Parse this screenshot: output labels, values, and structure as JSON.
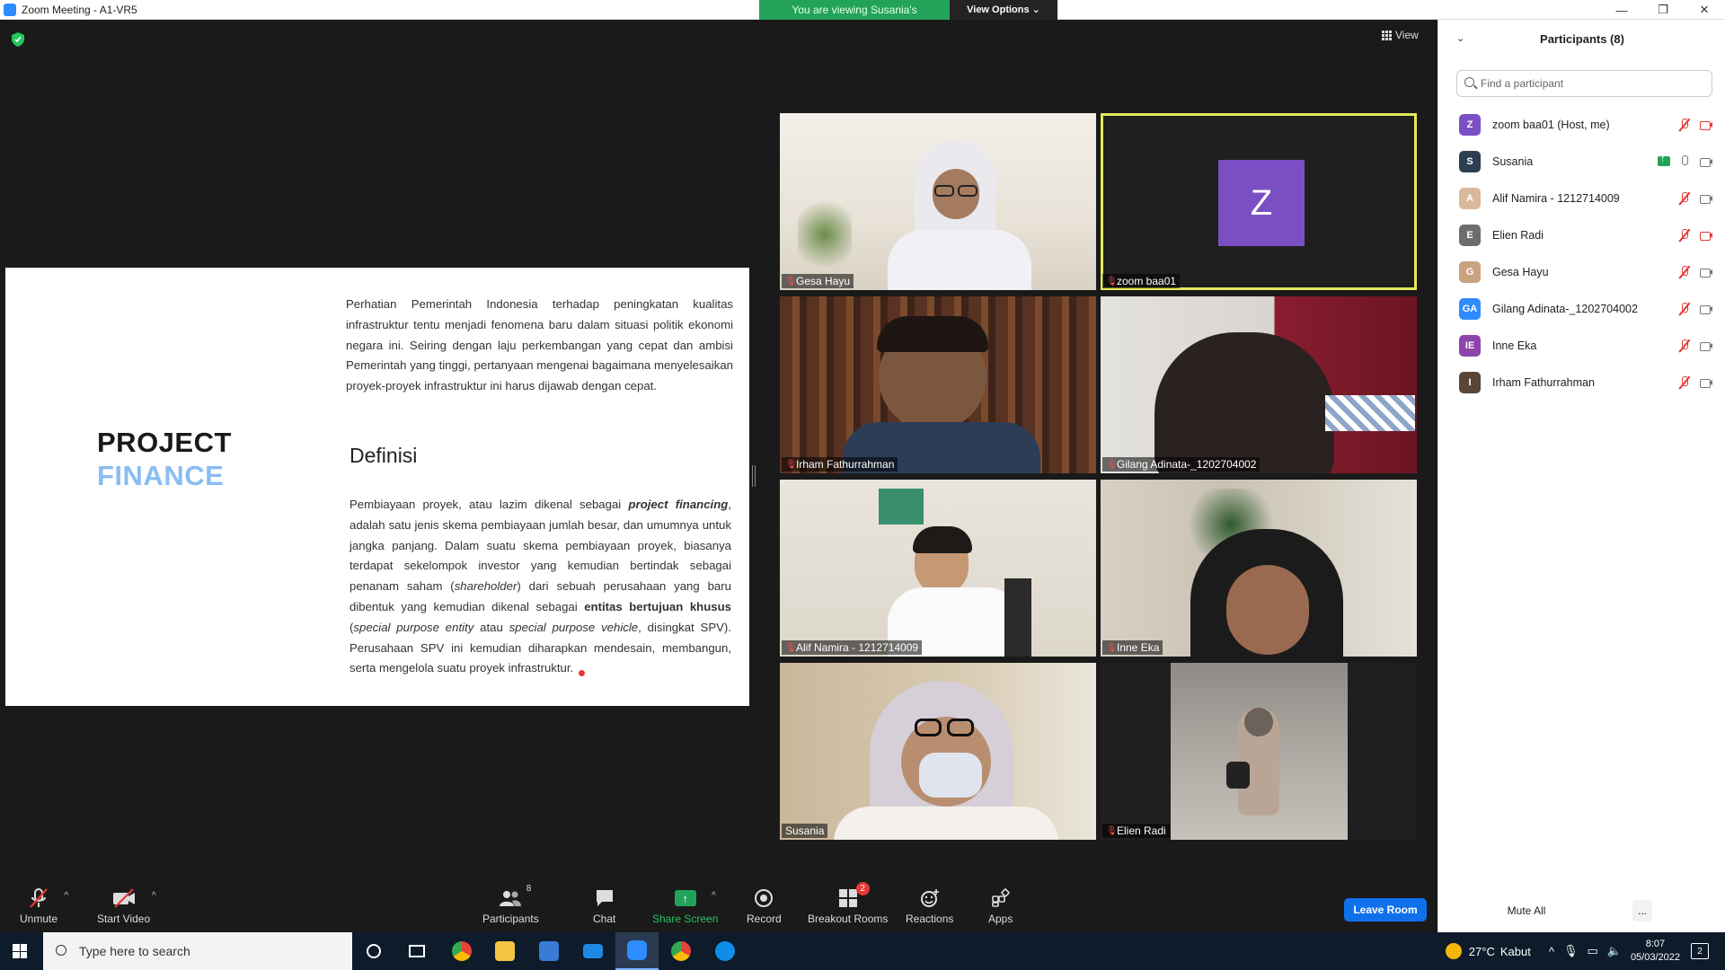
{
  "window": {
    "title": "Zoom Meeting - A1-VR5",
    "controls": [
      "—",
      "❐",
      "✕"
    ]
  },
  "share_banner": {
    "viewing_text": "You are viewing Susania's screen",
    "view_options_label": "View Options ⌄"
  },
  "meeting": {
    "view_label": "View"
  },
  "slide": {
    "heading_line1": "PROJECT",
    "heading_line2": "FINANCE",
    "paragraph1": "Perhatian Pemerintah Indonesia terhadap peningkatan kualitas infrastruktur tentu menjadi fenomena baru dalam situasi politik ekonomi negara ini. Seiring dengan laju perkembangan yang cepat dan ambisi Pemerintah yang tinggi, pertanyaan mengenai bagaimana menyelesaikan proyek-proyek infrastruktur ini harus dijawab dengan cepat.",
    "definition_title": "Definisi",
    "paragraph2_a": "Pembiayaan proyek, atau lazim dikenal sebagai ",
    "paragraph2_b": "project financing",
    "paragraph2_c": ", adalah satu jenis skema pembiayaan jumlah besar, dan umumnya untuk jangka panjang. Dalam suatu skema pembiayaan proyek, biasanya terdapat sekelompok investor yang kemudian bertindak sebagai penanam saham (",
    "paragraph2_d": "shareholder",
    "paragraph2_e": ") dari sebuah perusahaan yang baru dibentuk yang kemudian dikenal sebagai ",
    "paragraph2_f": "entitas bertujuan khusus",
    "paragraph2_g": " (",
    "paragraph2_h": "special purpose entity",
    "paragraph2_i": " atau ",
    "paragraph2_j": "special purpose vehicle",
    "paragraph2_k": ", disingkat SPV). Perusahaan SPV ini kemudian diharapkan mendesain, membangun, serta mengelola suatu proyek infrastruktur."
  },
  "gallery": [
    {
      "name": "Gesa Hayu",
      "muted": true
    },
    {
      "name": "zoom baa01",
      "muted": true,
      "avatar_letter": "Z",
      "active": true
    },
    {
      "name": "Irham Fathurrahman",
      "muted": true
    },
    {
      "name": "Gilang Adinata-_1202704002",
      "muted": true
    },
    {
      "name": "Alif Namira - 1212714009",
      "muted": true
    },
    {
      "name": "Inne Eka",
      "muted": true
    },
    {
      "name": "Susania",
      "muted": false
    },
    {
      "name": "Elien Radi",
      "muted": true
    }
  ],
  "participants": {
    "header": "Participants (8)",
    "collapse_icon": "⌄",
    "search_placeholder": "Find a participant",
    "list": [
      {
        "initials": "Z",
        "name": "zoom baa01 (Host, me)",
        "color": "#7b4fc4",
        "mic": "off",
        "cam": "off"
      },
      {
        "initials": "S",
        "name": "Susania",
        "color": "#2c3e50",
        "mic": "on",
        "cam": "on",
        "sharing": true
      },
      {
        "initials": "A",
        "name": "Alif Namira - 1212714009",
        "color": "#d9b99b",
        "mic": "off",
        "cam": "on"
      },
      {
        "initials": "E",
        "name": "Elien Radi",
        "color": "#6d6d6d",
        "mic": "off",
        "cam": "off"
      },
      {
        "initials": "G",
        "name": "Gesa Hayu",
        "color": "#c9a27e",
        "mic": "off",
        "cam": "on"
      },
      {
        "initials": "GA",
        "name": "Gilang Adinata-_1202704002",
        "color": "#2d8cff",
        "mic": "off",
        "cam": "on"
      },
      {
        "initials": "IE",
        "name": "Inne Eka",
        "color": "#8e44ad",
        "mic": "off",
        "cam": "on"
      },
      {
        "initials": "I",
        "name": "Irham Fathurrahman",
        "color": "#5a4636",
        "mic": "off",
        "cam": "on"
      }
    ],
    "mute_all_label": "Mute All",
    "more_label": "..."
  },
  "toolbar": {
    "unmute": "Unmute",
    "start_video": "Start Video",
    "participants": "Participants",
    "participants_count": "8",
    "chat": "Chat",
    "share_screen": "Share Screen",
    "record": "Record",
    "breakout_rooms": "Breakout Rooms",
    "breakout_badge": "2",
    "reactions": "Reactions",
    "apps": "Apps",
    "leave": "Leave Room"
  },
  "taskbar": {
    "search_placeholder": "Type here to search",
    "temperature": "27°C",
    "weather": "Kabut",
    "time": "8:07",
    "date": "05/03/2022",
    "notification_count": "2"
  }
}
